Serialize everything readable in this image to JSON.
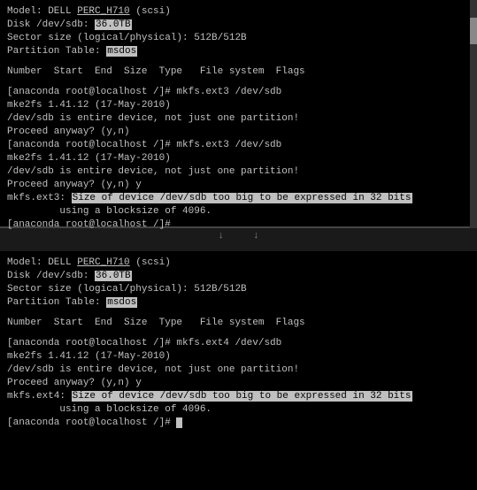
{
  "panel1": {
    "lines": [
      {
        "type": "normal",
        "text": "Model: DELL PERC_H710 (scsi)"
      },
      {
        "type": "disk",
        "text": "Disk /dev/sdb: ",
        "highlight": "36.0TB"
      },
      {
        "type": "normal",
        "text": "Sector size (logical/physical): 512B/512B"
      },
      {
        "type": "partition",
        "text": "Partition Table: ",
        "highlight": "msdos"
      },
      {
        "type": "empty"
      },
      {
        "type": "normal",
        "text": "Number  Start  End  Size  Type   File system  Flags"
      },
      {
        "type": "empty"
      },
      {
        "type": "cmd",
        "text": "[anaconda root@localhost /]# mkfs.ext3 /dev/sdb"
      },
      {
        "type": "normal",
        "text": "mke2fs 1.41.12 (17-May-2010)"
      },
      {
        "type": "normal",
        "text": "/dev/sdb is entire device, not just one partition!"
      },
      {
        "type": "normal",
        "text": "Proceed anyway? (y,n)"
      },
      {
        "type": "cmd",
        "text": "[anaconda root@localhost /]# mkfs.ext3 /dev/sdb"
      },
      {
        "type": "normal",
        "text": "mke2fs 1.41.12 (17-May-2010)"
      },
      {
        "type": "normal",
        "text": "/dev/sdb is entire device, not just one partition!"
      },
      {
        "type": "normal",
        "text": "Proceed anyway? (y,n) y"
      },
      {
        "type": "warning",
        "prefix": "mkfs.ext3: ",
        "highlight": "Size of device /dev/sdb too big to be expressed in 32 bits",
        "suffix": ""
      },
      {
        "type": "normal",
        "text": "         using a blocksize of 4096."
      },
      {
        "type": "cmd",
        "text": "[anaconda root@localhost /]#"
      }
    ]
  },
  "panel2": {
    "lines": [
      {
        "type": "normal",
        "text": "Model: DELL PERC_H710 (scsi)"
      },
      {
        "type": "disk",
        "text": "Disk /dev/sdb: ",
        "highlight": "36.0TB"
      },
      {
        "type": "normal",
        "text": "Sector size (logical/physical): 512B/512B"
      },
      {
        "type": "partition",
        "text": "Partition Table: ",
        "highlight": "msdos"
      },
      {
        "type": "empty"
      },
      {
        "type": "normal",
        "text": "Number  Start  End  Size  Type   File system  Flags"
      },
      {
        "type": "empty"
      },
      {
        "type": "cmd",
        "text": "[anaconda root@localhost /]# mkfs.ext4 /dev/sdb"
      },
      {
        "type": "normal",
        "text": "mke2fs 1.41.12 (17-May-2010)"
      },
      {
        "type": "normal",
        "text": "/dev/sdb is entire device, not just one partition!"
      },
      {
        "type": "normal",
        "text": "Proceed anyway? (y,n) y"
      },
      {
        "type": "warning",
        "prefix": "mkfs.ext4: ",
        "highlight": "Size of device /dev/sdb too big to be expressed in 32 bits",
        "suffix": ""
      },
      {
        "type": "normal",
        "text": "         using a blocksize of 4096."
      },
      {
        "type": "cmd-cursor",
        "text": "[anaconda root@localhost /]# "
      }
    ]
  },
  "separator": {
    "char": "↓"
  }
}
